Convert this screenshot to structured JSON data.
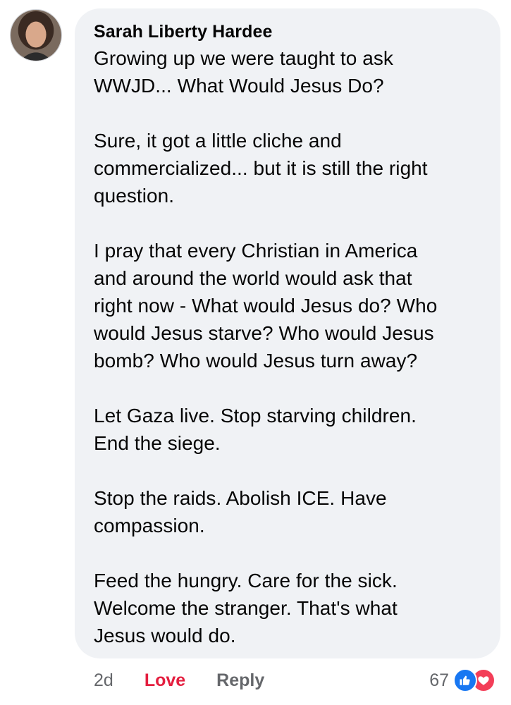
{
  "comment": {
    "author": "Sarah Liberty Hardee",
    "paragraphs": [
      [
        "Growing up we were taught to ask",
        "WWJD... What Would Jesus Do?"
      ],
      [
        "Sure, it got a little cliche and",
        "commercialized... but it is still the right",
        "question."
      ],
      [
        "I pray that every Christian in America",
        "and around the world would ask that",
        "right now - What would Jesus do? Who",
        "would Jesus starve? Who would Jesus",
        "bomb? Who would Jesus turn away?"
      ],
      [
        "Let Gaza live. Stop starving children.",
        "End the siege."
      ],
      [
        "Stop the raids. Abolish ICE. Have",
        "compassion."
      ],
      [
        "Feed the hungry. Care for the sick.",
        "Welcome the stranger. That's what",
        "Jesus would do."
      ]
    ]
  },
  "actions": {
    "timestamp": "2d",
    "love_label": "Love",
    "reply_label": "Reply"
  },
  "reactions": {
    "count": "67",
    "icons": [
      "like-icon",
      "heart-icon"
    ],
    "like_color": "#1877f2",
    "love_color": "#f33e58"
  },
  "colors": {
    "bubble_bg": "#f0f2f5",
    "meta_text": "#65676b",
    "love_text": "#e41e3f"
  }
}
